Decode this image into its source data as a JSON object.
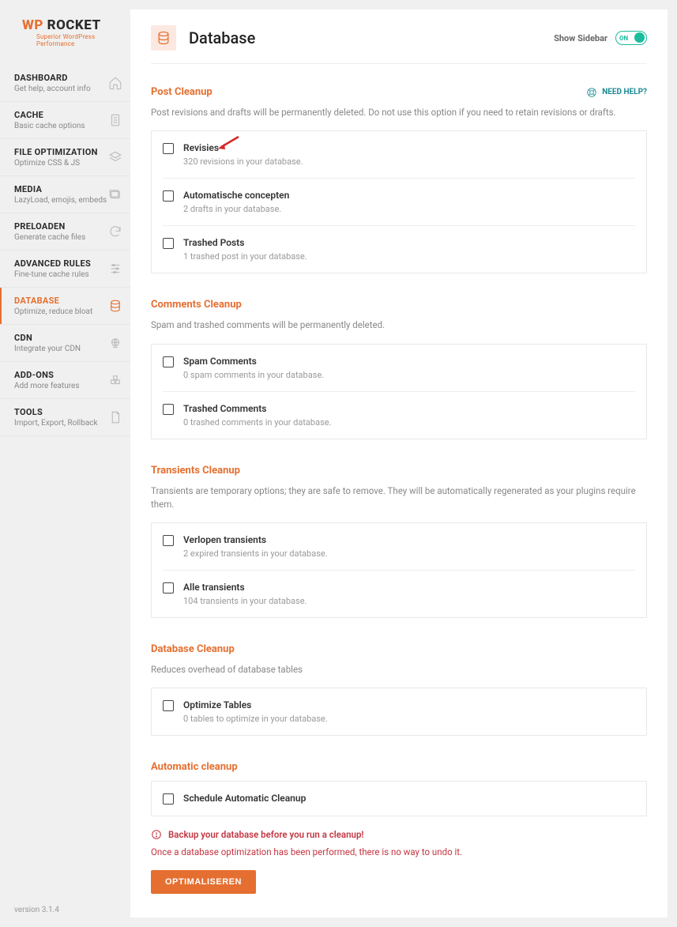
{
  "brand": {
    "wp": "WP",
    "rocket": " ROCKET",
    "tagline": "Superior WordPress Performance"
  },
  "nav": [
    {
      "title": "DASHBOARD",
      "desc": "Get help, account info"
    },
    {
      "title": "CACHE",
      "desc": "Basic cache options"
    },
    {
      "title": "FILE OPTIMIZATION",
      "desc": "Optimize CSS & JS"
    },
    {
      "title": "MEDIA",
      "desc": "LazyLoad, emojis, embeds"
    },
    {
      "title": "PRELOADEN",
      "desc": "Generate cache files"
    },
    {
      "title": "ADVANCED RULES",
      "desc": "Fine-tune cache rules"
    },
    {
      "title": "DATABASE",
      "desc": "Optimize, reduce bloat"
    },
    {
      "title": "CDN",
      "desc": "Integrate your CDN"
    },
    {
      "title": "ADD-ONS",
      "desc": "Add more features"
    },
    {
      "title": "TOOLS",
      "desc": "Import, Export, Rollback"
    }
  ],
  "version": "version 3.1.4",
  "page": {
    "title": "Database",
    "show_sidebar": "Show Sidebar",
    "toggle": "ON",
    "need_help": "NEED HELP?"
  },
  "sections": {
    "post": {
      "title": "Post Cleanup",
      "desc": "Post revisions and drafts will be permanently deleted. Do not use this option if you need to retain revisions or drafts.",
      "rows": [
        {
          "title": "Revisies",
          "desc": "320 revisions in your database."
        },
        {
          "title": "Automatische concepten",
          "desc": "2 drafts in your database."
        },
        {
          "title": "Trashed Posts",
          "desc": "1 trashed post in your database."
        }
      ]
    },
    "comments": {
      "title": "Comments Cleanup",
      "desc": "Spam and trashed comments will be permanently deleted.",
      "rows": [
        {
          "title": "Spam Comments",
          "desc": "0 spam comments in your database."
        },
        {
          "title": "Trashed Comments",
          "desc": "0 trashed comments in your database."
        }
      ]
    },
    "transients": {
      "title": "Transients Cleanup",
      "desc": "Transients are temporary options; they are safe to remove. They will be automatically regenerated as your plugins require them.",
      "rows": [
        {
          "title": "Verlopen transients",
          "desc": "2 expired transients in your database."
        },
        {
          "title": "Alle transients",
          "desc": "104 transients in your database."
        }
      ]
    },
    "database": {
      "title": "Database Cleanup",
      "desc": "Reduces overhead of database tables",
      "rows": [
        {
          "title": "Optimize Tables",
          "desc": "0 tables to optimize in your database."
        }
      ]
    },
    "automatic": {
      "title": "Automatic cleanup",
      "rows": [
        {
          "title": "Schedule Automatic Cleanup"
        }
      ]
    }
  },
  "warning": {
    "title": "Backup your database before you run a cleanup!",
    "sub": "Once a database optimization has been performed, there is no way to undo it."
  },
  "button": "OPTIMALISEREN"
}
